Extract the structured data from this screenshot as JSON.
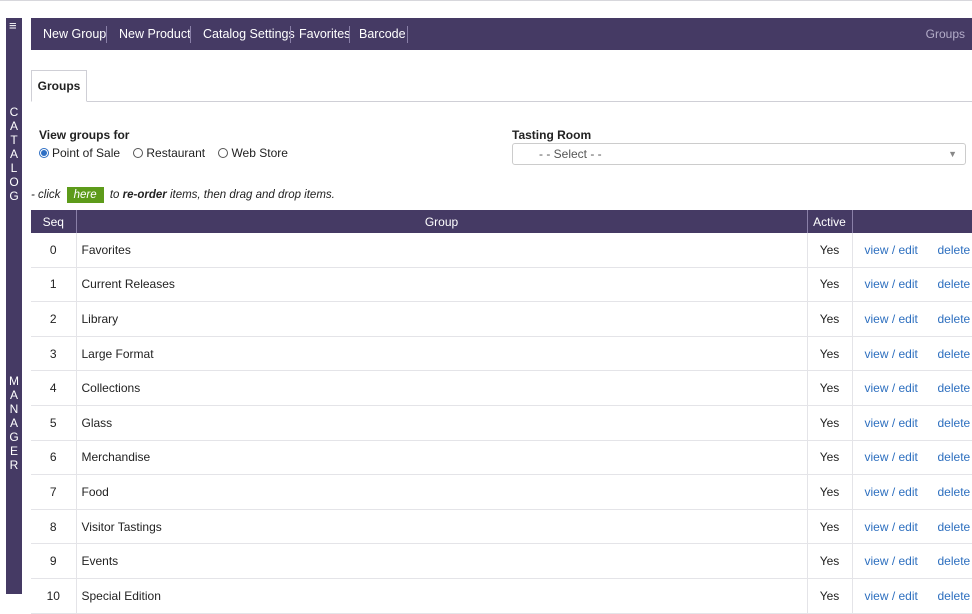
{
  "sidebar": {
    "menu_icon": "hamburger-icon",
    "letters_top": [
      "C",
      "A",
      "T",
      "A",
      "L",
      "O",
      "G"
    ],
    "letters_bottom": [
      "M",
      "A",
      "N",
      "A",
      "G",
      "E",
      "R"
    ]
  },
  "topnav": {
    "items": [
      "New Group",
      "New Product",
      "Catalog Settings",
      "Favorites",
      "Barcode"
    ],
    "current": "Groups"
  },
  "tabs": {
    "active": "Groups"
  },
  "filter": {
    "view_label": "View groups for",
    "options": [
      "Point of Sale",
      "Restaurant",
      "Web Store"
    ],
    "selected": "Point of Sale",
    "tasting_label": "Tasting Room",
    "tasting_select": "- - Select - -"
  },
  "reorder": {
    "prefix": "- click",
    "button": "here",
    "middle": "to",
    "bold": "re-order",
    "suffix": "items, then drag and drop items."
  },
  "table": {
    "headers": {
      "seq": "Seq",
      "group": "Group",
      "active": "Active",
      "actions": ""
    },
    "rows": [
      {
        "seq": "0",
        "group": "Favorites",
        "active": "Yes"
      },
      {
        "seq": "1",
        "group": "Current Releases",
        "active": "Yes"
      },
      {
        "seq": "2",
        "group": "Library",
        "active": "Yes"
      },
      {
        "seq": "3",
        "group": "Large Format",
        "active": "Yes"
      },
      {
        "seq": "4",
        "group": "Collections",
        "active": "Yes"
      },
      {
        "seq": "5",
        "group": "Glass",
        "active": "Yes"
      },
      {
        "seq": "6",
        "group": "Merchandise",
        "active": "Yes"
      },
      {
        "seq": "7",
        "group": "Food",
        "active": "Yes"
      },
      {
        "seq": "8",
        "group": "Visitor Tastings",
        "active": "Yes"
      },
      {
        "seq": "9",
        "group": "Events",
        "active": "Yes"
      },
      {
        "seq": "10",
        "group": "Special Edition",
        "active": "Yes"
      }
    ],
    "edit_label": "view / edit",
    "delete_label": "delete"
  },
  "colors": {
    "brand": "#453a64",
    "link": "#2d6fbf",
    "accent_green": "#5d9b1a"
  }
}
